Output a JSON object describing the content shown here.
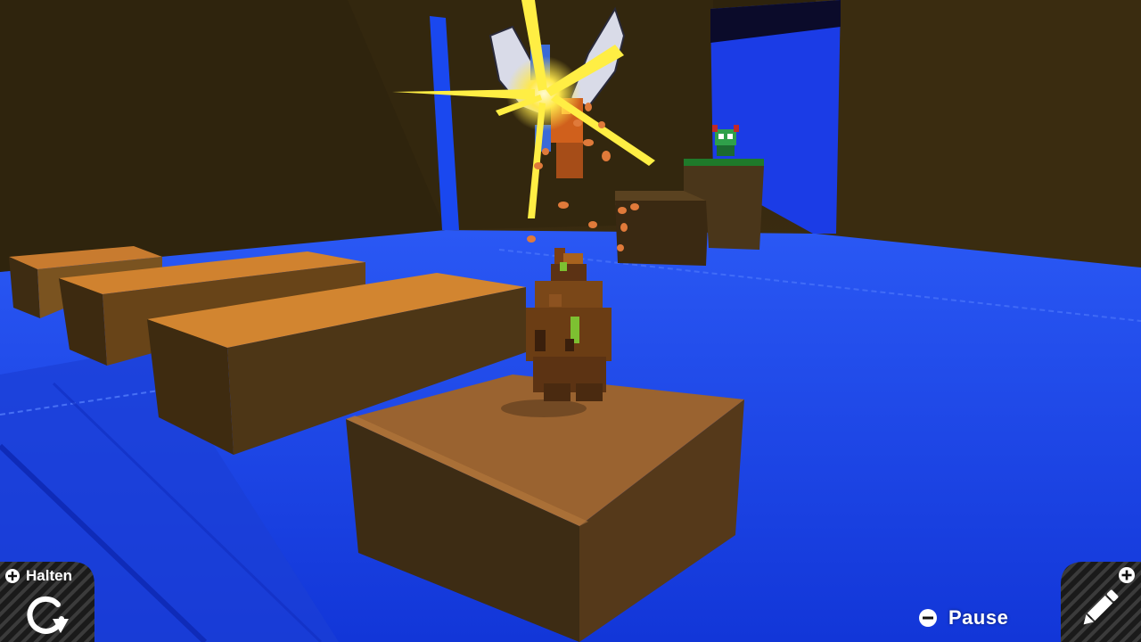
{
  "hud": {
    "hold_label": "Halten",
    "pause_label": "Pause",
    "hold_icon": "rotate-icon",
    "edit_icon": "pencil-icon"
  },
  "colors": {
    "floor": "#1f4cf0",
    "wall": "#3a2b10",
    "block_top": "#c9772e",
    "block_side": "#4a3418",
    "hud_stripes": "#1c1c1c"
  }
}
